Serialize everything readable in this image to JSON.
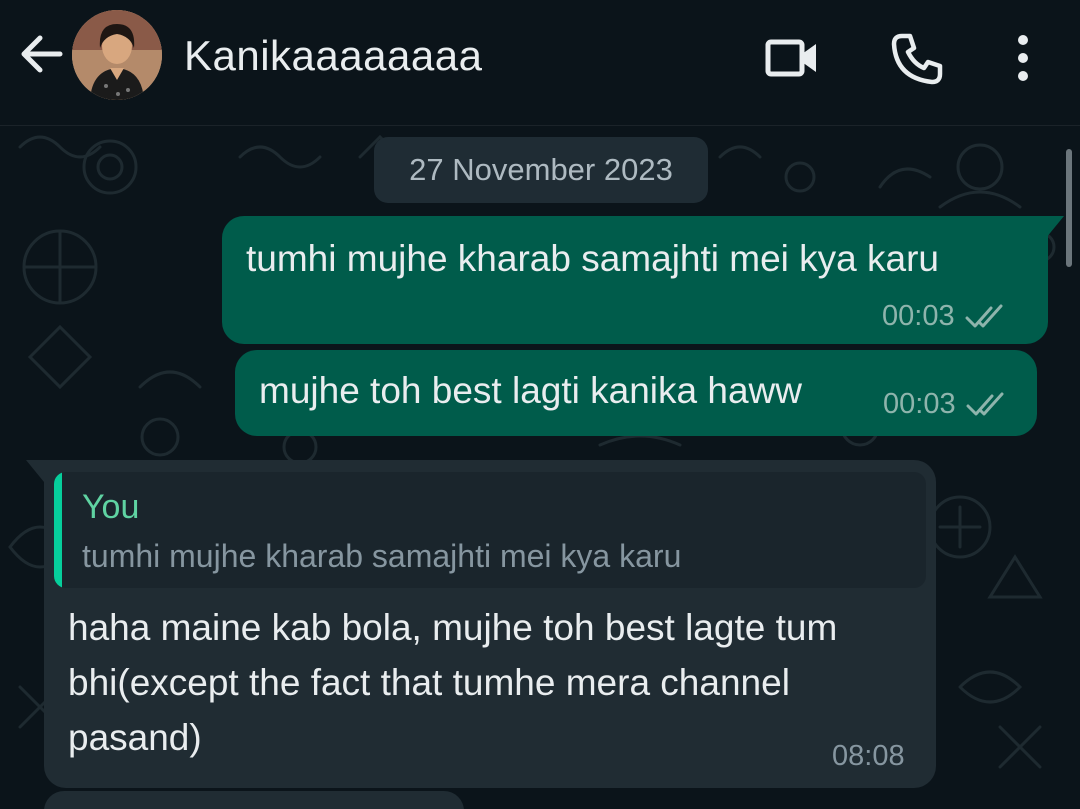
{
  "header": {
    "contact_name": "Kanikaaaaaaaa",
    "back_icon": "arrow-left-icon",
    "avatar": "contact-avatar",
    "video_icon": "video-call-icon",
    "call_icon": "phone-icon",
    "menu_icon": "more-vertical-icon"
  },
  "chat": {
    "date_label": "27 November 2023",
    "messages": [
      {
        "direction": "outgoing",
        "text": "tumhi mujhe kharab samajhti mei kya karu",
        "time": "00:03",
        "status": "read"
      },
      {
        "direction": "outgoing",
        "text": "mujhe toh best lagti kanika haww",
        "time": "00:03",
        "status": "read"
      },
      {
        "direction": "incoming",
        "quote": {
          "author": "You",
          "text": "tumhi mujhe kharab samajhti mei kya karu"
        },
        "text": "haha maine kab bola, mujhe toh best lagte tum bhi(except the fact that tumhe mera channel pasand)",
        "time": "08:08"
      }
    ]
  },
  "colors": {
    "background": "#0b141a",
    "outgoing_bubble": "#005c4b",
    "incoming_bubble": "#202c33",
    "quote_accent": "#06cf9c",
    "text": "#e9edef"
  }
}
